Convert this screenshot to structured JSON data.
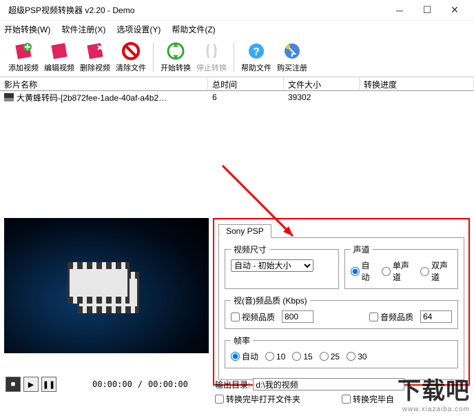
{
  "window": {
    "title": "超级PSP视频转换器 v2.20 - Demo"
  },
  "menu": {
    "start": "开始转换(W)",
    "register": "软件注册(X)",
    "options": "选项设置(Y)",
    "help": "帮助文件(Z)"
  },
  "toolbar": {
    "add": "添加视频",
    "edit": "编辑视频",
    "delete": "删除视频",
    "clear": "清除文件",
    "start": "开始转换",
    "stop": "停止转换",
    "help": "帮助文件",
    "buy": "购买注册"
  },
  "columns": {
    "name": "影片名称",
    "duration": "总时间",
    "size": "文件大小",
    "progress": "转换进度"
  },
  "rows": [
    {
      "name": "大黄蜂转码-[2b872fee-1ade-40af-a4b2…",
      "duration": "6",
      "size": "39302",
      "progress": ""
    }
  ],
  "settings": {
    "tab": "Sony PSP",
    "video_size_label": "视频尺寸",
    "video_size_value": "自动 - 初始大小",
    "channel_label": "声道",
    "channel_auto": "自动",
    "channel_mono": "单声道",
    "channel_stereo": "双声道",
    "quality_label": "视(音)频品质 (Kbps)",
    "video_quality_label": "视频品质",
    "video_quality_value": "800",
    "audio_quality_label": "音频品质",
    "audio_quality_value": "64",
    "fps_label": "帧率",
    "fps_auto": "自动",
    "fps_10": "10",
    "fps_15": "15",
    "fps_25": "25",
    "fps_30": "30"
  },
  "output": {
    "label": "输出目录:",
    "value": "d:\\我的视频"
  },
  "transport": {
    "tc1": "00:00:00",
    "tc2": "00:00:00"
  },
  "checks": {
    "open_after": "转换完毕打开文件夹",
    "shutdown": "转换完毕自"
  },
  "watermark": {
    "text": "下载吧",
    "url": "www.xiazaiba.com"
  }
}
